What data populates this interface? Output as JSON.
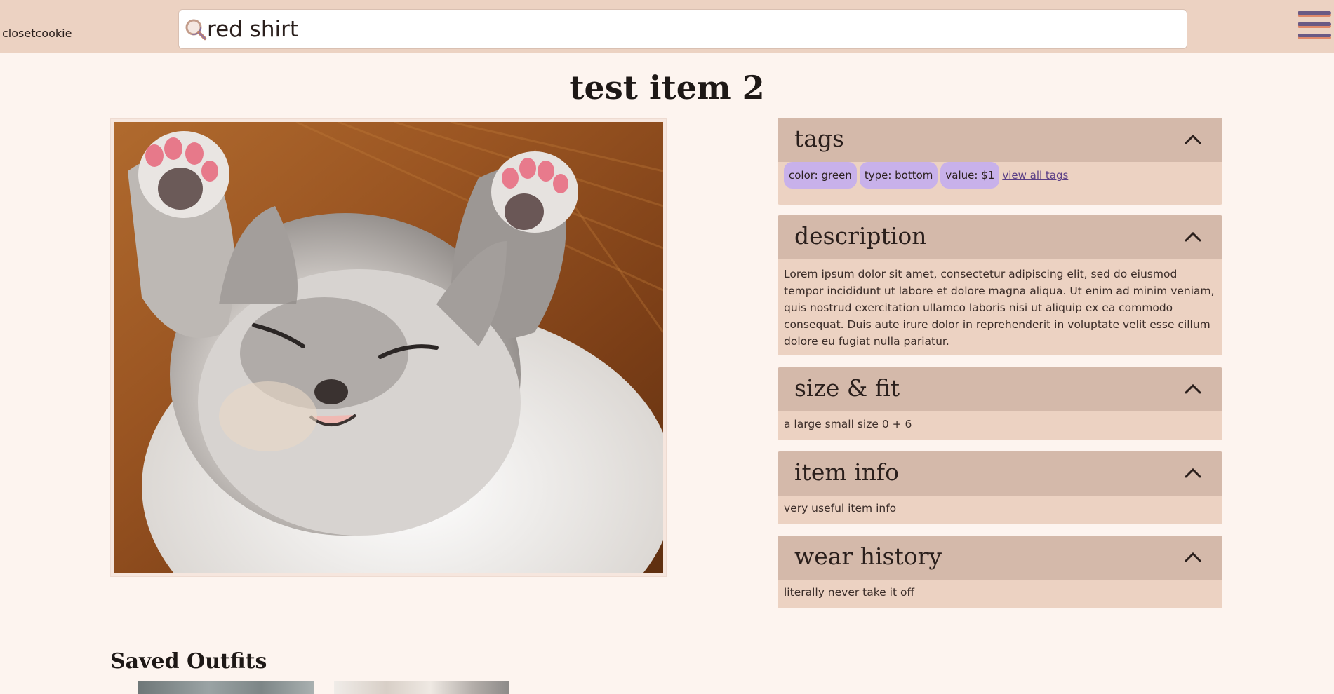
{
  "header": {
    "brand": "closetcookie",
    "search": {
      "value": "red shirt",
      "placeholder": ""
    },
    "icons": {
      "search": "search-icon",
      "menu": "hamburger-menu-icon"
    }
  },
  "item": {
    "title": "test item 2",
    "image": "sleeping kitten photo"
  },
  "panels": {
    "tags": {
      "title": "tags",
      "items": [
        "color: green",
        "type: bottom",
        "value: $1"
      ],
      "view_all": "view all tags"
    },
    "description": {
      "title": "description",
      "text": "Lorem ipsum dolor sit amet, consectetur adipiscing elit, sed do eiusmod tempor incididunt ut labore et dolore magna aliqua. Ut enim ad minim veniam, quis nostrud exercitation ullamco laboris nisi ut aliquip ex ea commodo consequat. Duis aute irure dolor in reprehenderit in voluptate velit esse cillum dolore eu fugiat nulla pariatur."
    },
    "size_fit": {
      "title": "size & fit",
      "text": "a large small size 0 + 6"
    },
    "item_info": {
      "title": "item info",
      "text": "very useful item info"
    },
    "wear_history": {
      "title": "wear history",
      "text": "literally never take it off"
    }
  },
  "saved_outfits": {
    "title": "Saved Outfits"
  },
  "colors": {
    "header_bg": "#ecd2c2",
    "page_bg": "#fdf4ef",
    "panel_header": "#d4b9aa",
    "panel_body": "#ecd2c2",
    "tag_bg": "#c8b1ea",
    "link": "#5b3f86"
  }
}
